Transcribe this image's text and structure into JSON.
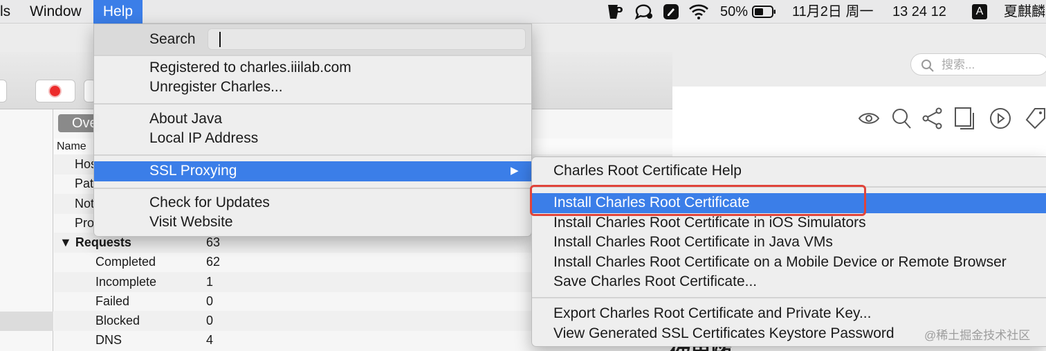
{
  "menubar": {
    "items": [
      "ls",
      "Window",
      "Help"
    ],
    "battery": "50%",
    "date": "11月2日 周一",
    "time": "13 24 12",
    "input_method": "A",
    "user": "夏麒麟"
  },
  "app": {
    "tab_overview": "Ove",
    "column_header": "Name",
    "rows": [
      {
        "key": "Hos",
        "value": ""
      },
      {
        "key": "Pat",
        "value": ""
      },
      {
        "key": "Not",
        "value": ""
      },
      {
        "key": "Pro",
        "value": ""
      },
      {
        "key": "▼  Requests",
        "value": "63"
      },
      {
        "key": "Completed",
        "value": "62"
      },
      {
        "key": "Incomplete",
        "value": "1"
      },
      {
        "key": "Failed",
        "value": "0"
      },
      {
        "key": "Blocked",
        "value": "0"
      },
      {
        "key": "DNS",
        "value": "4"
      }
    ]
  },
  "browser": {
    "search_placeholder": "搜索...",
    "title_fragment": "你串随"
  },
  "help_menu": {
    "search_label": "Search",
    "items": [
      "Registered to charles.iiilab.com",
      "Unregister Charles...",
      "About Java",
      "Local IP Address",
      "SSL Proxying",
      "Check for Updates",
      "Visit Website"
    ],
    "submenu_arrow": "▶"
  },
  "ssl_submenu": {
    "items": [
      "Charles Root Certificate Help",
      "Install Charles Root Certificate",
      "Install Charles Root Certificate in iOS Simulators",
      "Install Charles Root Certificate in Java VMs",
      "Install Charles Root Certificate on a Mobile Device or Remote Browser",
      "Save Charles Root Certificate...",
      "Export Charles Root Certificate and Private Key...",
      "View Generated SSL Certificates Keystore Password"
    ]
  },
  "watermark": "@稀土掘金技术社区",
  "colors": {
    "selection": "#3b7ee8",
    "highlight_box": "#e0443a",
    "record": "#ec2b2b"
  }
}
